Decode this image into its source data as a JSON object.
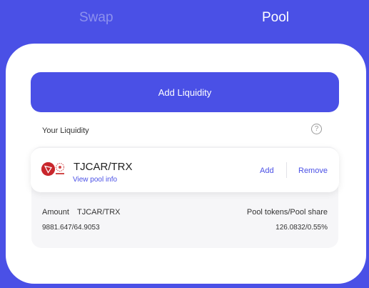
{
  "tabs": {
    "swap": "Swap",
    "pool": "Pool"
  },
  "colors": {
    "accent": "#4a50e6",
    "tab_inactive": "#8d91ee",
    "card": "#ffffff",
    "panel": "#f6f6f8"
  },
  "add_liquidity": {
    "label": "Add Liquidity"
  },
  "your_liquidity": {
    "title": "Your Liquidity",
    "help_icon": "?"
  },
  "position": {
    "pair": "TJCAR/TRX",
    "view_info": "View pool info",
    "add": "Add",
    "remove": "Remove",
    "token_icons": [
      "tron-logo-icon",
      "jcar-logo-icon"
    ],
    "amount_label": "Amount",
    "pair_label": "TJCAR/TRX",
    "amount_value": "9881.647/64.9053",
    "share_label": "Pool tokens/Pool share",
    "share_value": "126.0832/0.55%"
  }
}
